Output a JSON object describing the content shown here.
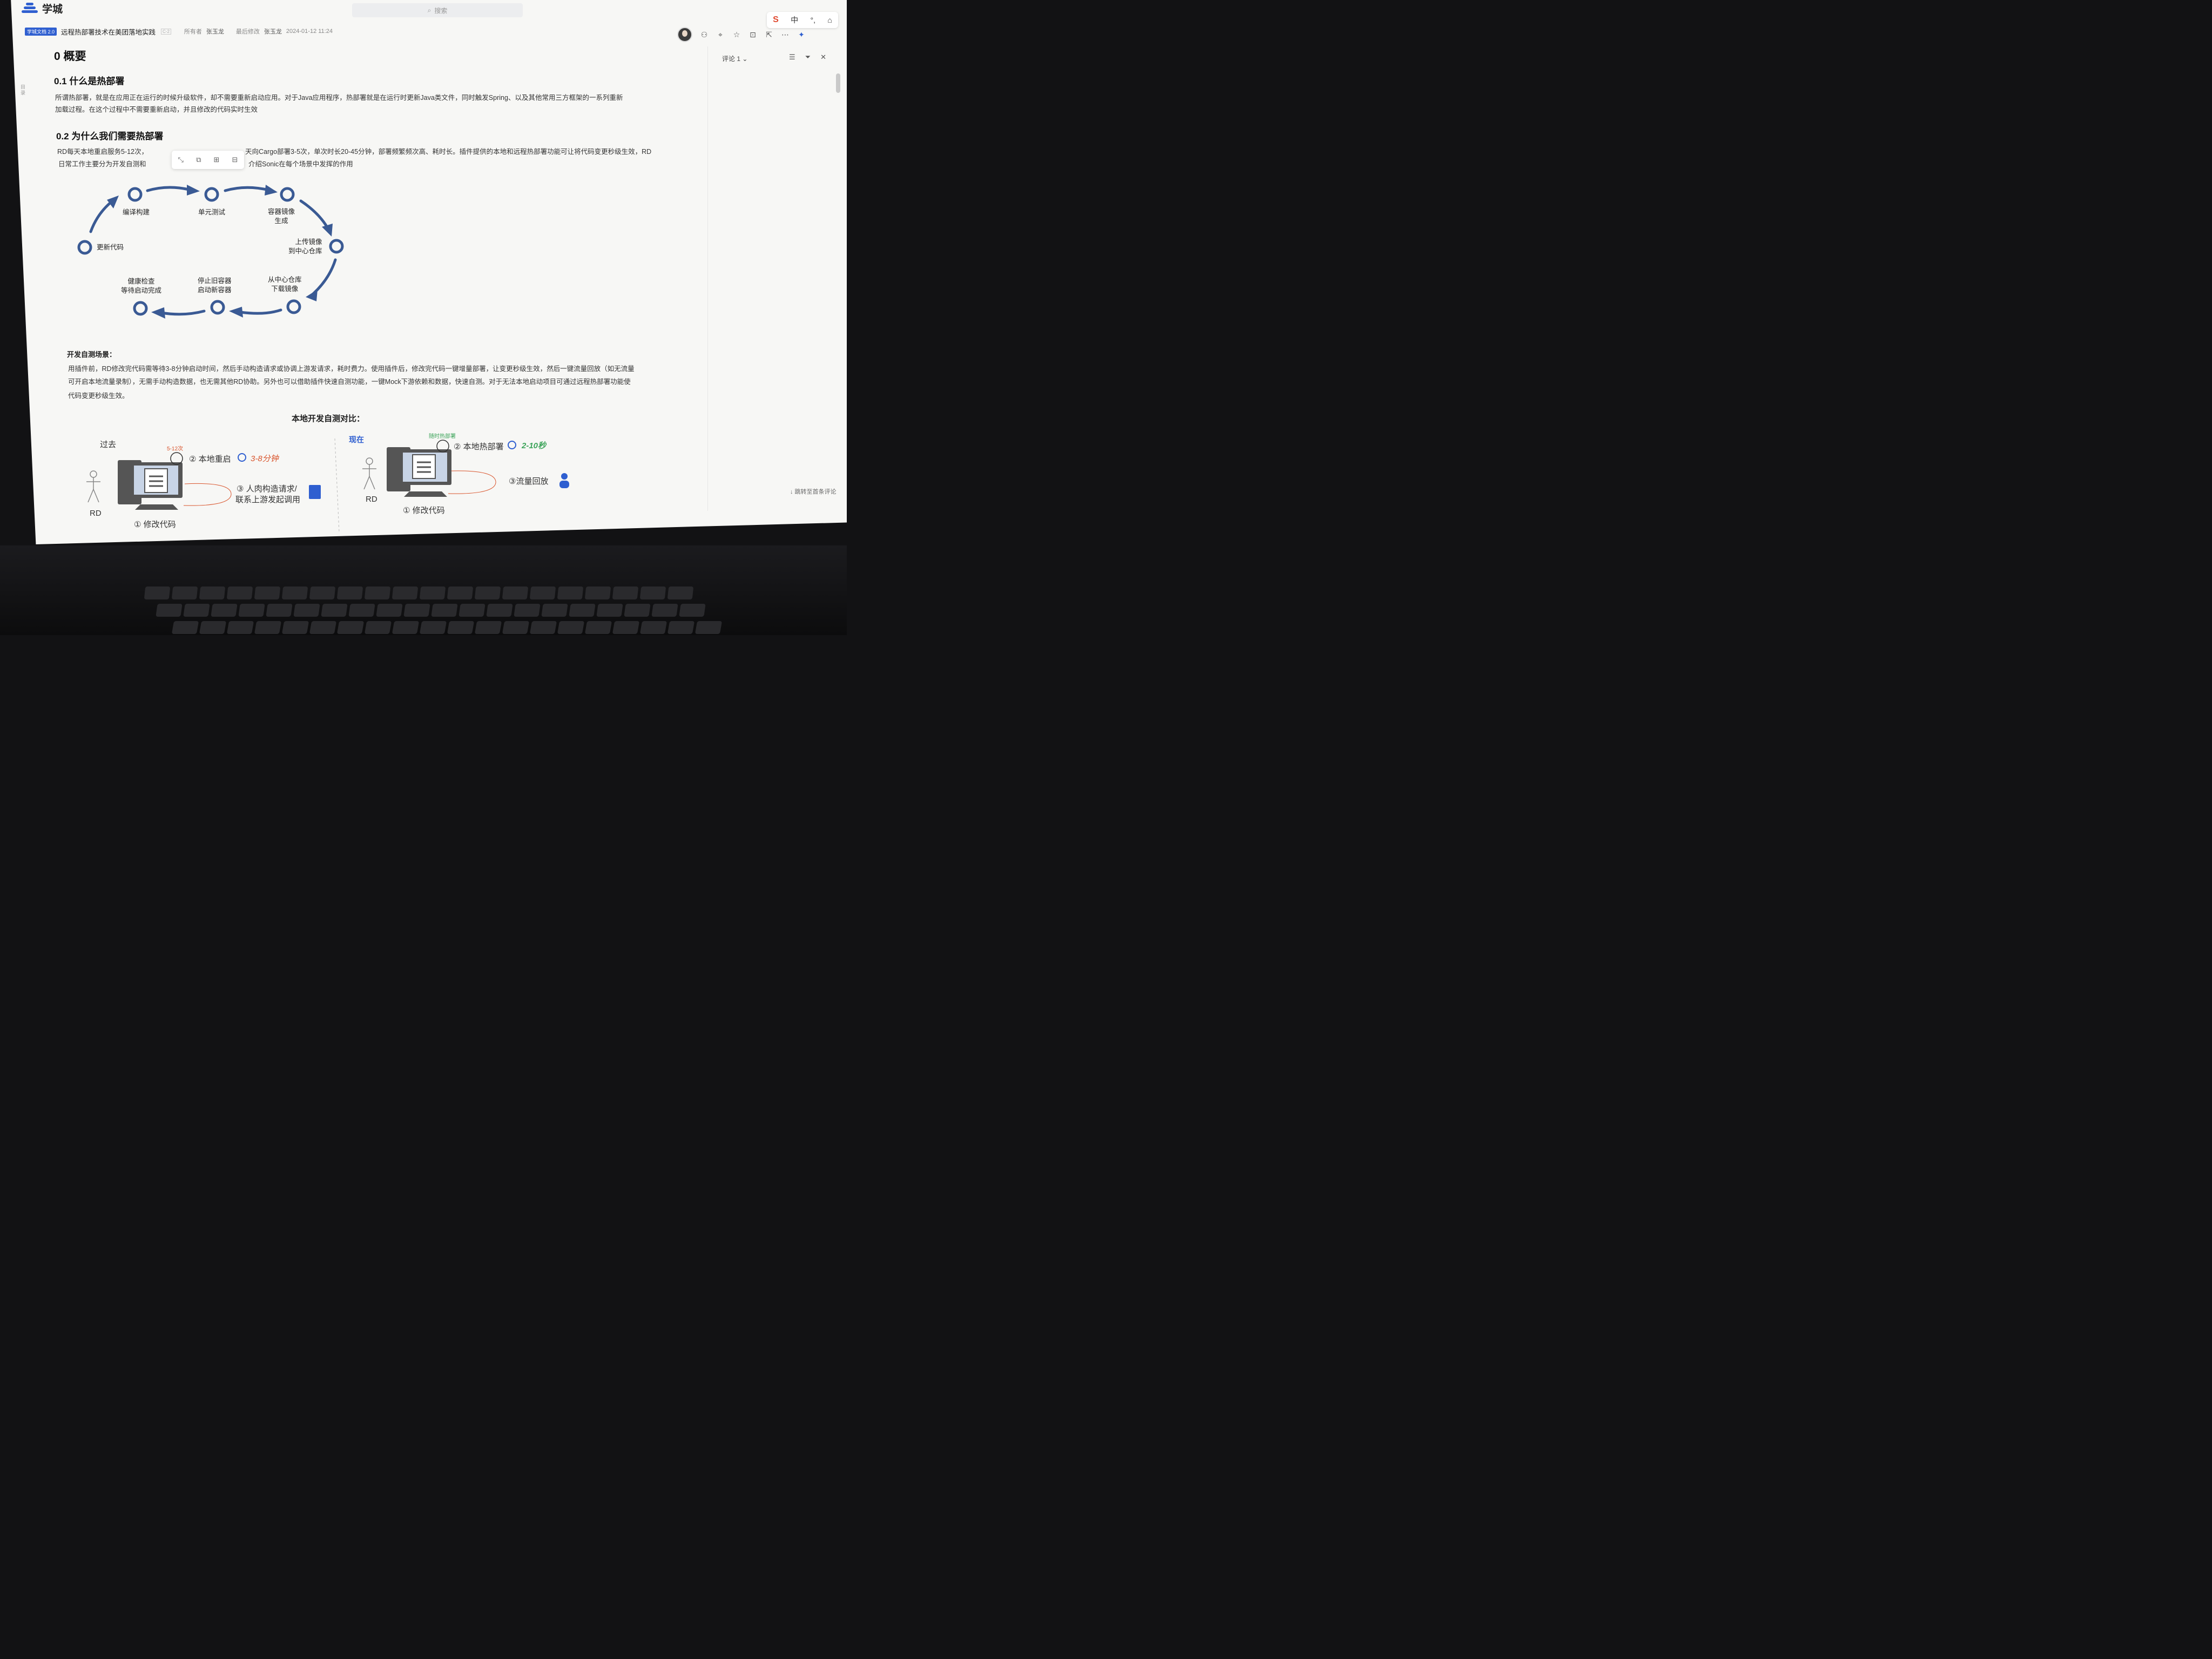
{
  "app": {
    "name": "学城",
    "search_placeholder": "搜索"
  },
  "ime": {
    "s": "S",
    "lang": "中",
    "punct": "°,",
    "shirt": "👕"
  },
  "doc": {
    "badge": "学城文档 2.0",
    "title": "远程热部署技术在美团落地实践",
    "tag": "C-2",
    "owner_label": "所有者",
    "owner": "张玉龙",
    "modified_label": "最后修改",
    "modified_by": "张玉龙",
    "modified_at": "2024-01-12 11:24"
  },
  "sidebar": {
    "toc": "目录"
  },
  "content": {
    "h0": "0 概要",
    "h01": "0.1 什么是热部署",
    "p01_line1": "所谓热部署，就是在应用正在运行的时候升级软件，却不需要重新启动应用。对于Java应用程序，热部署就是在运行时更新Java类文件，同时触发Spring、以及其他常用三方框架的一系列重新",
    "p01_line2": "加载过程。在这个过程中不需要重新启动，并且修改的代码实时生效",
    "h02": "0.2 为什么我们需要热部署",
    "p02_line1a": "RD每天本地重启服务5-12次，",
    "p02_line1b": "天向Cargo部署3-5次，单次时长20-45分钟，部署频繁频次高、耗时长。插件提供的本地和远程热部署功能可让将代码变更秒级生效，RD",
    "p02_line2a": "日常工作主要分为开发自测和",
    "p02_line2b": "介绍Sonic在每个场景中发挥的作用",
    "selfcheck_title": "开发自测场景：",
    "p03_line1": "用插件前，RD修改完代码需等待3-8分钟启动时间，然后手动构造请求或协调上游发请求，耗时费力。使用插件后，修改完代码一键增量部署，让变更秒级生效，然后一键流量回放（如无流量",
    "p03_line2": "可开启本地流量录制），无需手动构造数据，也无需其他RD协助。另外也可以借助插件快速自测功能，一键Mock下游依赖和数据，快速自测。对于无法本地启动项目可通过远程热部署功能使",
    "p03_line3": "代码变更秒级生效。",
    "compare_title": "本地开发自测对比："
  },
  "cycle": {
    "steps": [
      "编译构建",
      "单元测试",
      "容器镜像\n生成",
      "上传镜像\n到中心仓库",
      "从中心仓库\n下载镜像",
      "停止旧容器\n启动新容器",
      "健康检查\n等待启动完成",
      "更新代码"
    ]
  },
  "compare": {
    "past": {
      "label": "过去",
      "count": "5-12次",
      "step2": "② 本地重启",
      "step2_time": "3-8分钟",
      "step3_l1": "③ 人肉构造请求/",
      "step3_l2": "联系上游发起调用",
      "step1": "① 修改代码",
      "person": "RD"
    },
    "now": {
      "label": "现在",
      "anytime": "随时热部署",
      "step2": "② 本地热部署",
      "step2_time": "2-10秒",
      "step3": "③流量回放",
      "step1": "① 修改代码",
      "person": "RD"
    }
  },
  "comments": {
    "header": "评论 1",
    "jump": "↓ 跳转至首条评论"
  },
  "colors": {
    "accent": "#2f5fd0",
    "cycle": "#3a5a94",
    "red": "#d9542c",
    "green": "#3da45a"
  }
}
